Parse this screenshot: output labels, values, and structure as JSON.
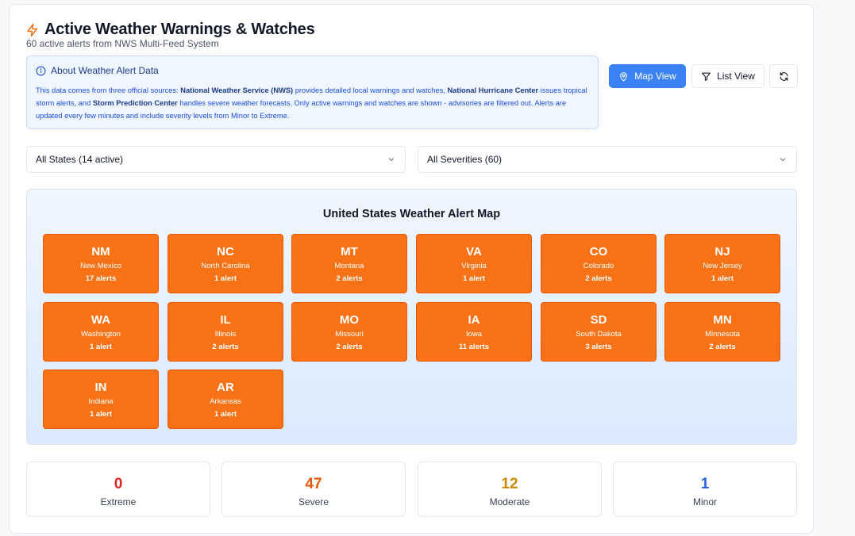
{
  "header": {
    "title": "Active Weather Warnings & Watches",
    "subtitle": "60 active alerts from NWS Multi-Feed System",
    "icon": "lightning-icon",
    "accent": "#f97316"
  },
  "info_box": {
    "heading": "About Weather Alert Data",
    "text_1": "This data comes from three official sources: ",
    "nws": "National Weather Service (NWS)",
    "text_2": " provides detailed local warnings and watches, ",
    "nhc": "National Hurricane Center",
    "text_3": " issues tropical storm alerts, and ",
    "spc": "Storm Prediction Center",
    "text_4": " handles severe weather forecasts. Only active warnings and watches are shown - advisories are filtered out. Alerts are updated every few minutes and include severity levels from Minor to Extreme."
  },
  "toolbar": {
    "map_view": "Map View",
    "list_view": "List View",
    "map_active_color": "#3b82f6"
  },
  "filters": {
    "state": "All States (14 active)",
    "severity": "All Severities (60)"
  },
  "map": {
    "title": "United States Weather Alert Map",
    "states": [
      {
        "abbr": "NM",
        "name": "New Mexico",
        "count": "17 alerts"
      },
      {
        "abbr": "NC",
        "name": "North Carolina",
        "count": "1 alert"
      },
      {
        "abbr": "MT",
        "name": "Montana",
        "count": "2 alerts"
      },
      {
        "abbr": "VA",
        "name": "Virginia",
        "count": "1 alert"
      },
      {
        "abbr": "CO",
        "name": "Colorado",
        "count": "2 alerts"
      },
      {
        "abbr": "NJ",
        "name": "New Jersey",
        "count": "1 alert"
      },
      {
        "abbr": "WA",
        "name": "Washington",
        "count": "1 alert"
      },
      {
        "abbr": "IL",
        "name": "Illinois",
        "count": "2 alerts"
      },
      {
        "abbr": "MO",
        "name": "Missouri",
        "count": "2 alerts"
      },
      {
        "abbr": "IA",
        "name": "Iowa",
        "count": "11 alerts"
      },
      {
        "abbr": "SD",
        "name": "South Dakota",
        "count": "3 alerts"
      },
      {
        "abbr": "MN",
        "name": "Minnesota",
        "count": "2 alerts"
      },
      {
        "abbr": "IN",
        "name": "Indiana",
        "count": "1 alert"
      },
      {
        "abbr": "AR",
        "name": "Arkansas",
        "count": "1 alert"
      }
    ]
  },
  "severity_stats": [
    {
      "value": "0",
      "label": "Extreme",
      "color": "#dc2626"
    },
    {
      "value": "47",
      "label": "Severe",
      "color": "#ea580c"
    },
    {
      "value": "12",
      "label": "Moderate",
      "color": "#ca8a04"
    },
    {
      "value": "1",
      "label": "Minor",
      "color": "#2563eb"
    }
  ]
}
